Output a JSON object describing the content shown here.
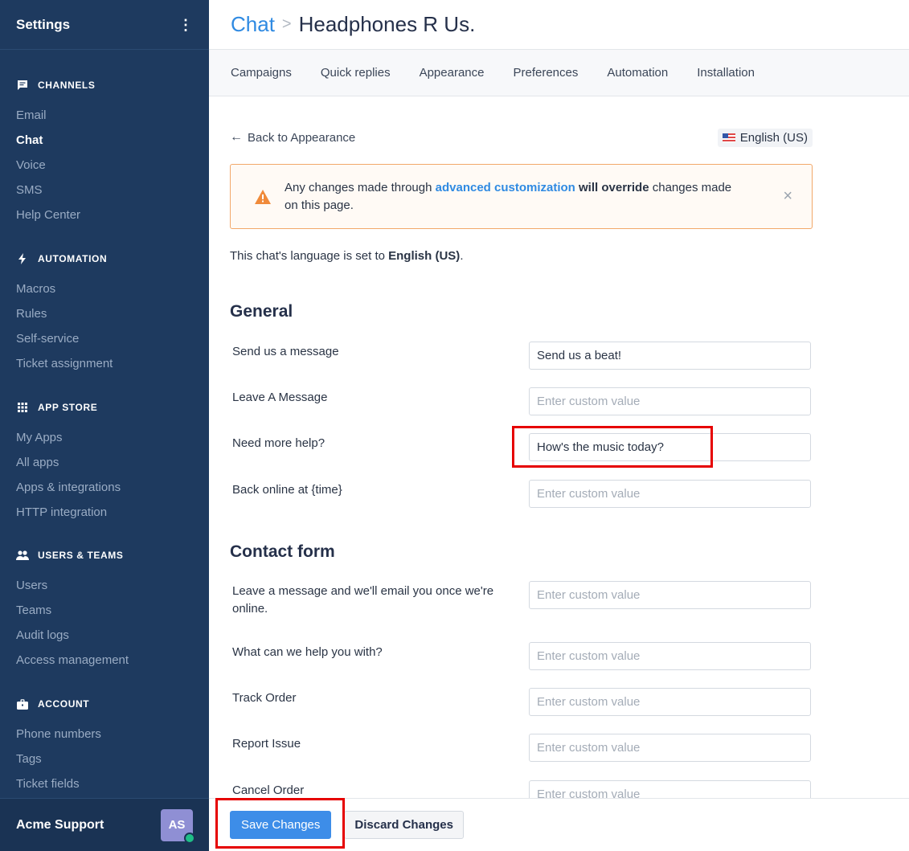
{
  "sidebar": {
    "title": "Settings",
    "menu_icon": "kebab-menu-icon",
    "sections": [
      {
        "title": "CHANNELS",
        "icon": "chat-bubble-icon",
        "items": [
          "Email",
          "Chat",
          "Voice",
          "SMS",
          "Help Center"
        ],
        "active": "Chat"
      },
      {
        "title": "AUTOMATION",
        "icon": "lightning-bolt-icon",
        "items": [
          "Macros",
          "Rules",
          "Self-service",
          "Ticket assignment"
        ]
      },
      {
        "title": "APP STORE",
        "icon": "grid-icon",
        "items": [
          "My Apps",
          "All apps",
          "Apps & integrations",
          "HTTP integration"
        ]
      },
      {
        "title": "USERS & TEAMS",
        "icon": "users-icon",
        "items": [
          "Users",
          "Teams",
          "Audit logs",
          "Access management"
        ]
      },
      {
        "title": "ACCOUNT",
        "icon": "briefcase-icon",
        "items": [
          "Phone numbers",
          "Tags",
          "Ticket fields"
        ]
      }
    ],
    "footer": {
      "name": "Acme Support",
      "avatar_initials": "AS",
      "avatar_color": "#8f8fd4",
      "presence_color": "#1fbf87"
    }
  },
  "header": {
    "breadcrumb_link": "Chat",
    "breadcrumb_sep": ">",
    "breadcrumb_current": "Headphones R Us."
  },
  "tabs": [
    "Campaigns",
    "Quick replies",
    "Appearance",
    "Preferences",
    "Automation",
    "Installation"
  ],
  "back": {
    "arrow": "←",
    "label": "Back to Appearance"
  },
  "language_badge": {
    "flag": "us-flag-icon",
    "label": "English (US)"
  },
  "alert": {
    "icon": "warning-triangle-icon",
    "text_before": "Any changes made through ",
    "link": "advanced customization",
    "bold": "will override",
    "text_after": " changes made on this page.",
    "close": "×"
  },
  "language_line": {
    "prefix": "This chat's language is set to ",
    "language": "English (US)",
    "suffix": "."
  },
  "general": {
    "title": "General",
    "rows": [
      {
        "label": "Send us a message",
        "value": "Send us a beat!",
        "placeholder": "Enter custom value"
      },
      {
        "label": "Leave A Message",
        "value": "",
        "placeholder": "Enter custom value"
      },
      {
        "label": "Need more help?",
        "value": "How's the music today?",
        "placeholder": "Enter custom value"
      },
      {
        "label": "Back online at {time}",
        "value": "",
        "placeholder": "Enter custom value"
      }
    ]
  },
  "contact_form": {
    "title": "Contact form",
    "rows": [
      {
        "label": "Leave a message and we'll email you once we're online.",
        "value": "",
        "placeholder": "Enter custom value"
      },
      {
        "label": "What can we help you with?",
        "value": "",
        "placeholder": "Enter custom value"
      },
      {
        "label": "Track Order",
        "value": "",
        "placeholder": "Enter custom value"
      },
      {
        "label": "Report Issue",
        "value": "",
        "placeholder": "Enter custom value"
      },
      {
        "label": "Cancel Order",
        "value": "",
        "placeholder": "Enter custom value"
      }
    ]
  },
  "footer": {
    "save_label": "Save Changes",
    "discard_label": "Discard Changes"
  },
  "colors": {
    "sidebar_bg": "#1e3a5f",
    "accent": "#3d8de8",
    "link": "#2f8ae2",
    "warning": "#f2a86a",
    "highlight": "#e60000"
  }
}
